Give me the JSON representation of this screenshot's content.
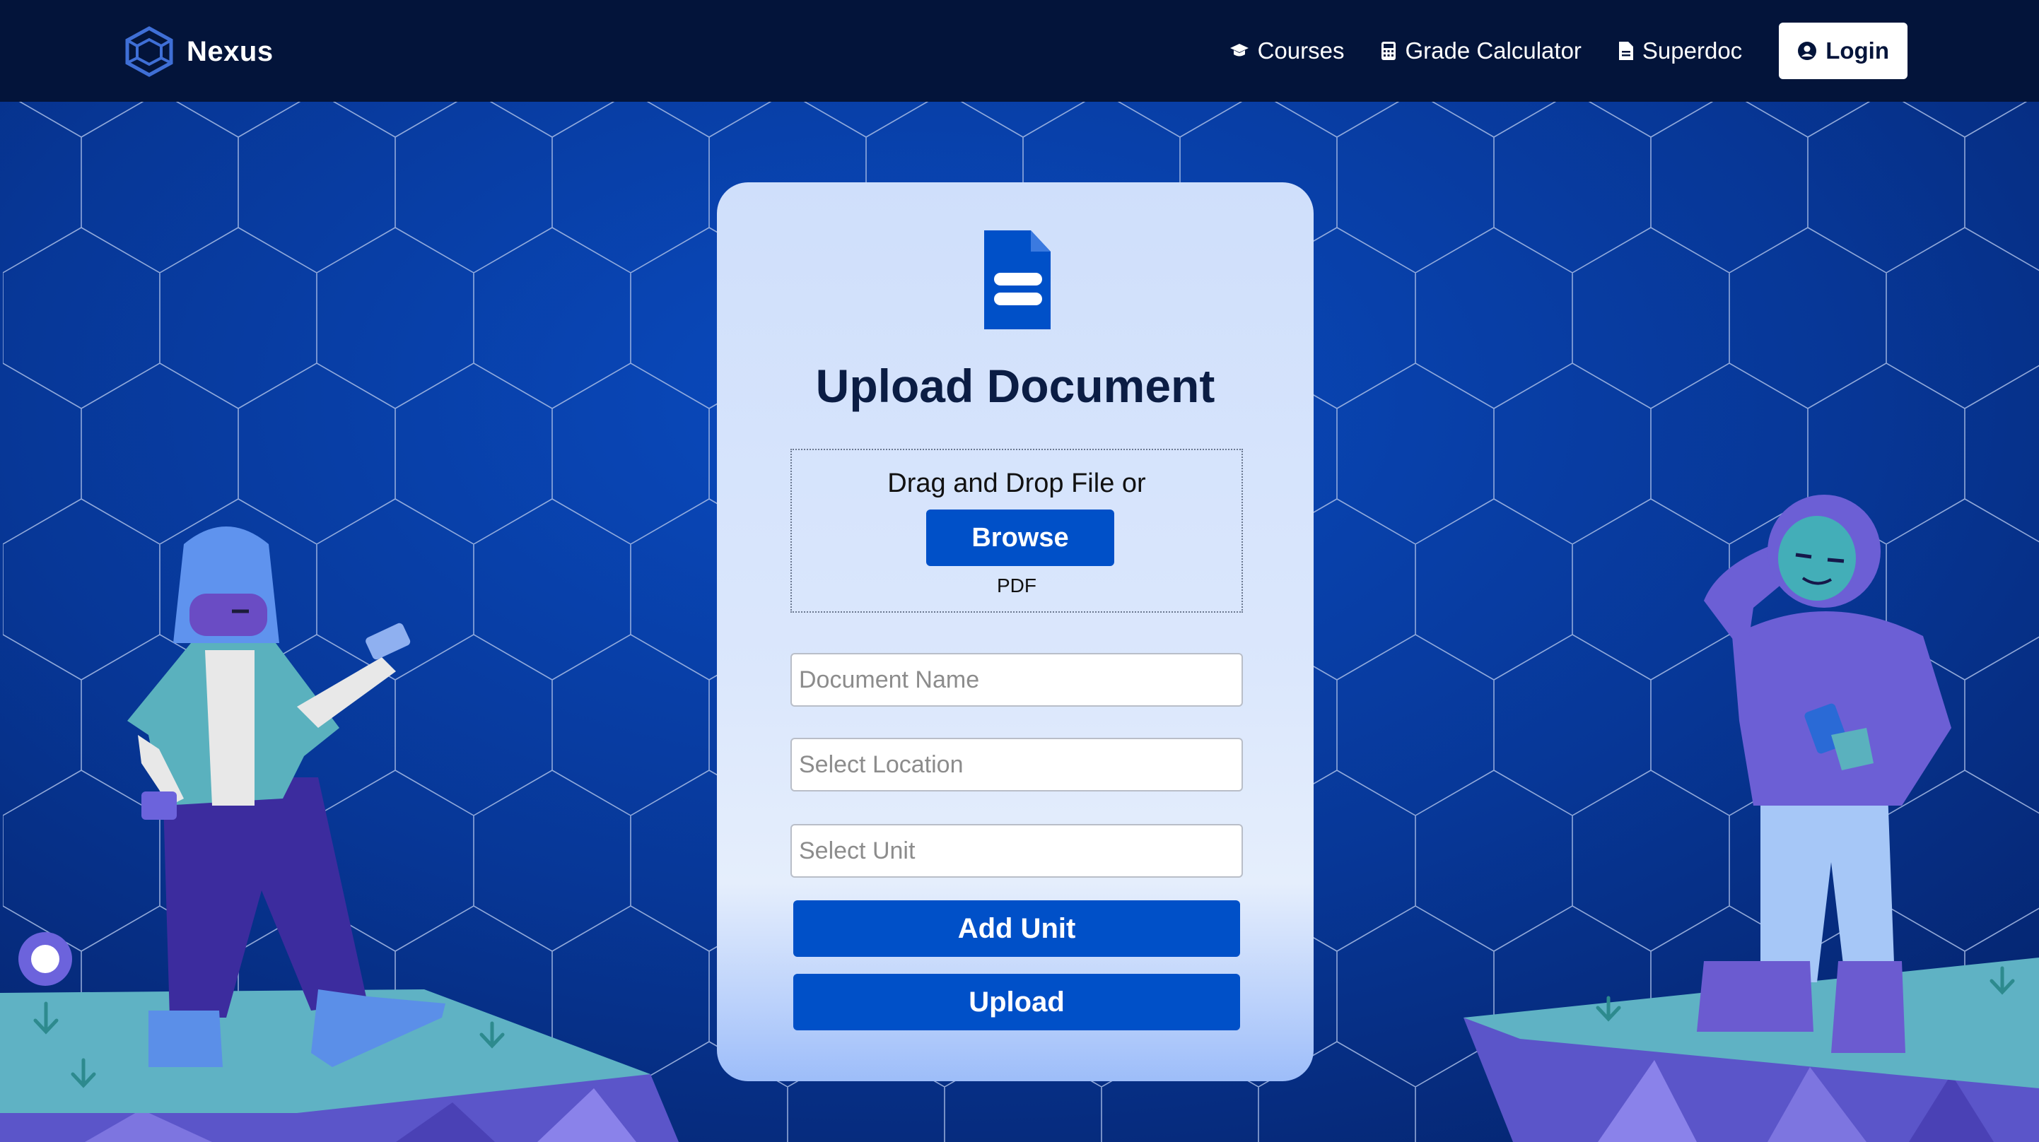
{
  "navbar": {
    "brand": "Nexus",
    "links": [
      {
        "label": "Courses",
        "icon": "graduation-cap-icon"
      },
      {
        "label": "Grade Calculator",
        "icon": "calculator-icon"
      },
      {
        "label": "Superdoc",
        "icon": "document-icon"
      }
    ],
    "login_label": "Login"
  },
  "upload": {
    "title": "Upload Document",
    "dropzone_text": "Drag and Drop File or",
    "browse_label": "Browse",
    "file_type": "PDF",
    "document_name_placeholder": "Document Name",
    "location_placeholder": "Select Location",
    "unit_placeholder": "Select Unit",
    "add_unit_label": "Add Unit",
    "upload_label": "Upload"
  },
  "colors": {
    "navbar_bg": "#03143a",
    "primary": "#0050c8",
    "background": "#0a3a9c",
    "card_bg": "#dbe7fc"
  }
}
